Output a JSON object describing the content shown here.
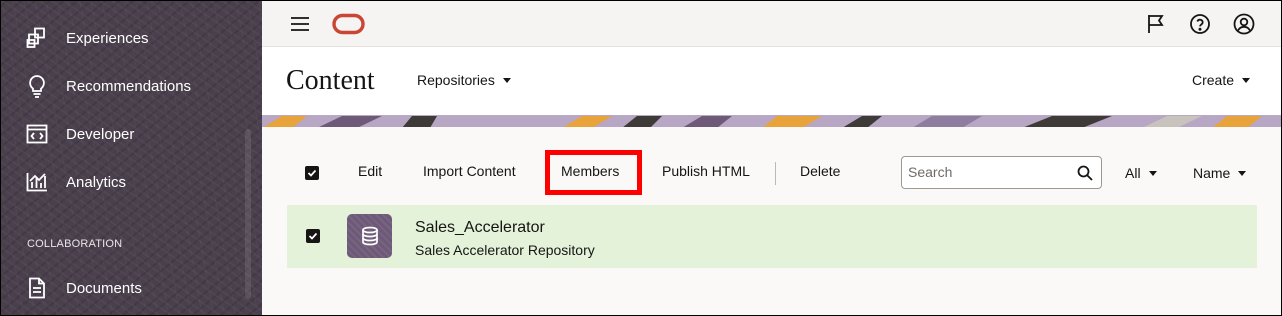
{
  "sidebar": {
    "items": [
      {
        "label": "Experiences",
        "icon": "experiences-icon"
      },
      {
        "label": "Recommendations",
        "icon": "lightbulb-icon"
      },
      {
        "label": "Developer",
        "icon": "code-icon"
      },
      {
        "label": "Analytics",
        "icon": "bar-chart-icon"
      }
    ],
    "section_header": "COLLABORATION",
    "collab_items": [
      {
        "label": "Documents",
        "icon": "document-icon"
      }
    ]
  },
  "topbar": {
    "menu_icon": "hamburger-icon",
    "logo": "oracle-logo",
    "icons": [
      "flag-icon",
      "help-icon",
      "user-icon"
    ]
  },
  "header": {
    "title": "Content",
    "repositories_label": "Repositories",
    "create_label": "Create"
  },
  "toolbar": {
    "edit_label": "Edit",
    "import_label": "Import Content",
    "members_label": "Members",
    "publish_label": "Publish HTML",
    "delete_label": "Delete",
    "search_placeholder": "Search",
    "filter_label": "All",
    "sort_label": "Name"
  },
  "repository": {
    "name": "Sales_Accelerator",
    "description": "Sales Accelerator Repository",
    "selected": true
  },
  "colors": {
    "sidebar_bg": "#4a3f4c",
    "row_selected_bg": "#e4f2da",
    "highlight_box": "#ff0000",
    "oracle_red": "#c74634"
  }
}
